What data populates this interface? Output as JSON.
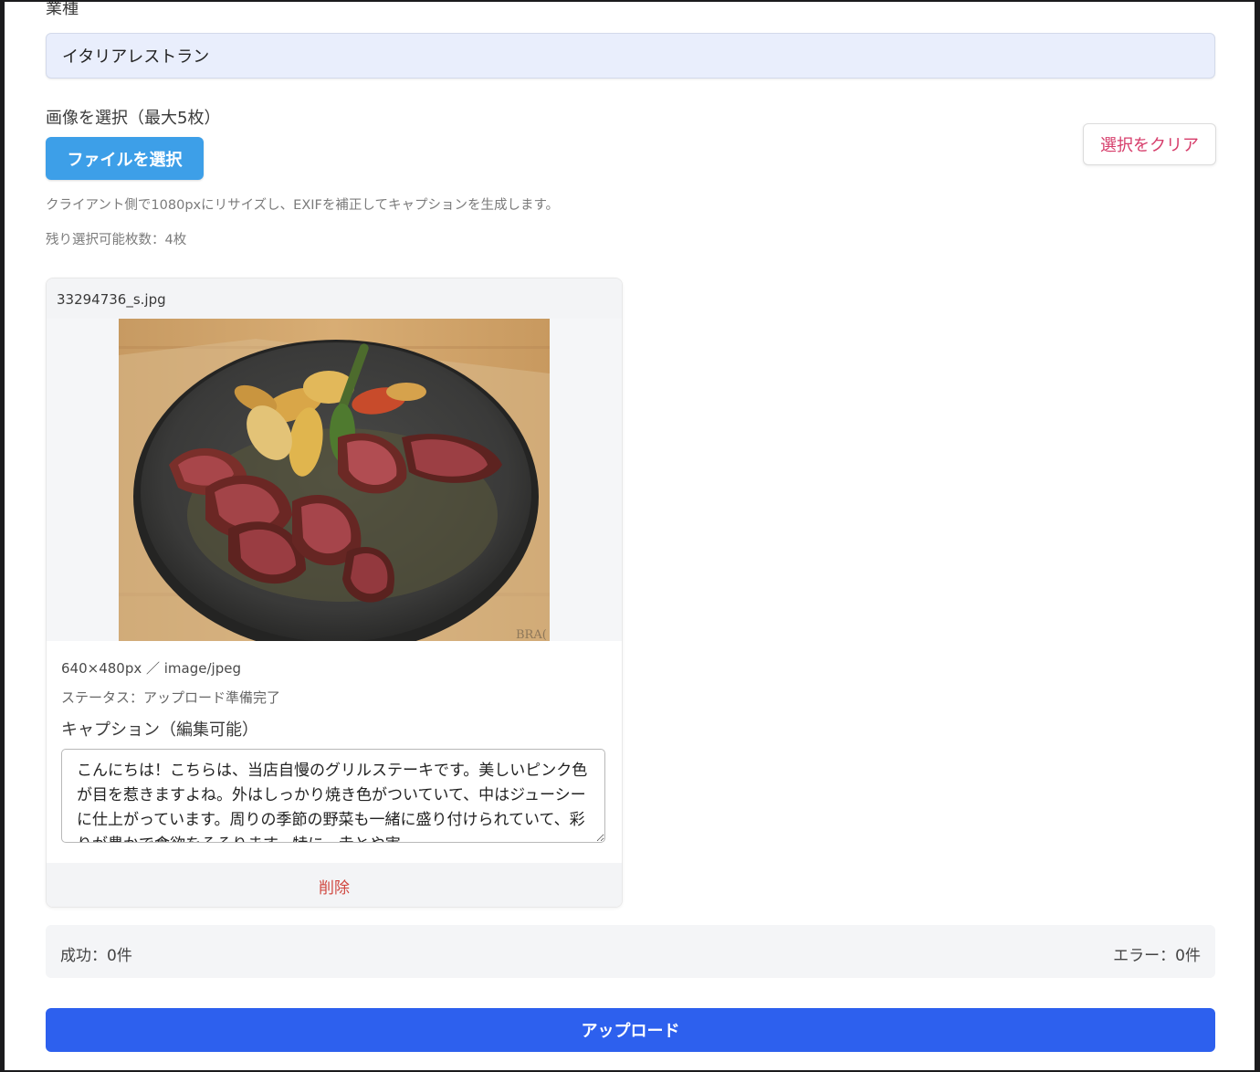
{
  "form": {
    "industry_label": "業種",
    "industry_value": "イタリアレストラン",
    "images_label": "画像を選択（最大5枚）",
    "file_button_label": "ファイルを選択",
    "clear_button_label": "選択をクリア",
    "resize_hint": "クライアント側で1080pxにリサイズし、EXIFを補正してキャプションを生成します。",
    "remaining_hint": "残り選択可能枚数：4枚"
  },
  "image_card": {
    "filename": "33294736_s.jpg",
    "size_info": "640×480px ／ image/jpeg",
    "status": "ステータス：アップロード準備完了",
    "caption_label": "キャプション（編集可能）",
    "caption_text": "こんにちは！こちらは、当店自慢のグリルステーキです。美しいピンク色が目を惹きますよね。外はしっかり焼き色がついていて、中はジューシーに仕上がっています。周りの季節の野菜も一緒に盛り付けられていて、彩りが豊かで食欲をそそります。特に、赤とや実",
    "delete_label": "削除"
  },
  "summary": {
    "success": "成功：0件",
    "error": "エラー：0件"
  },
  "upload_button_label": "アップロード"
}
